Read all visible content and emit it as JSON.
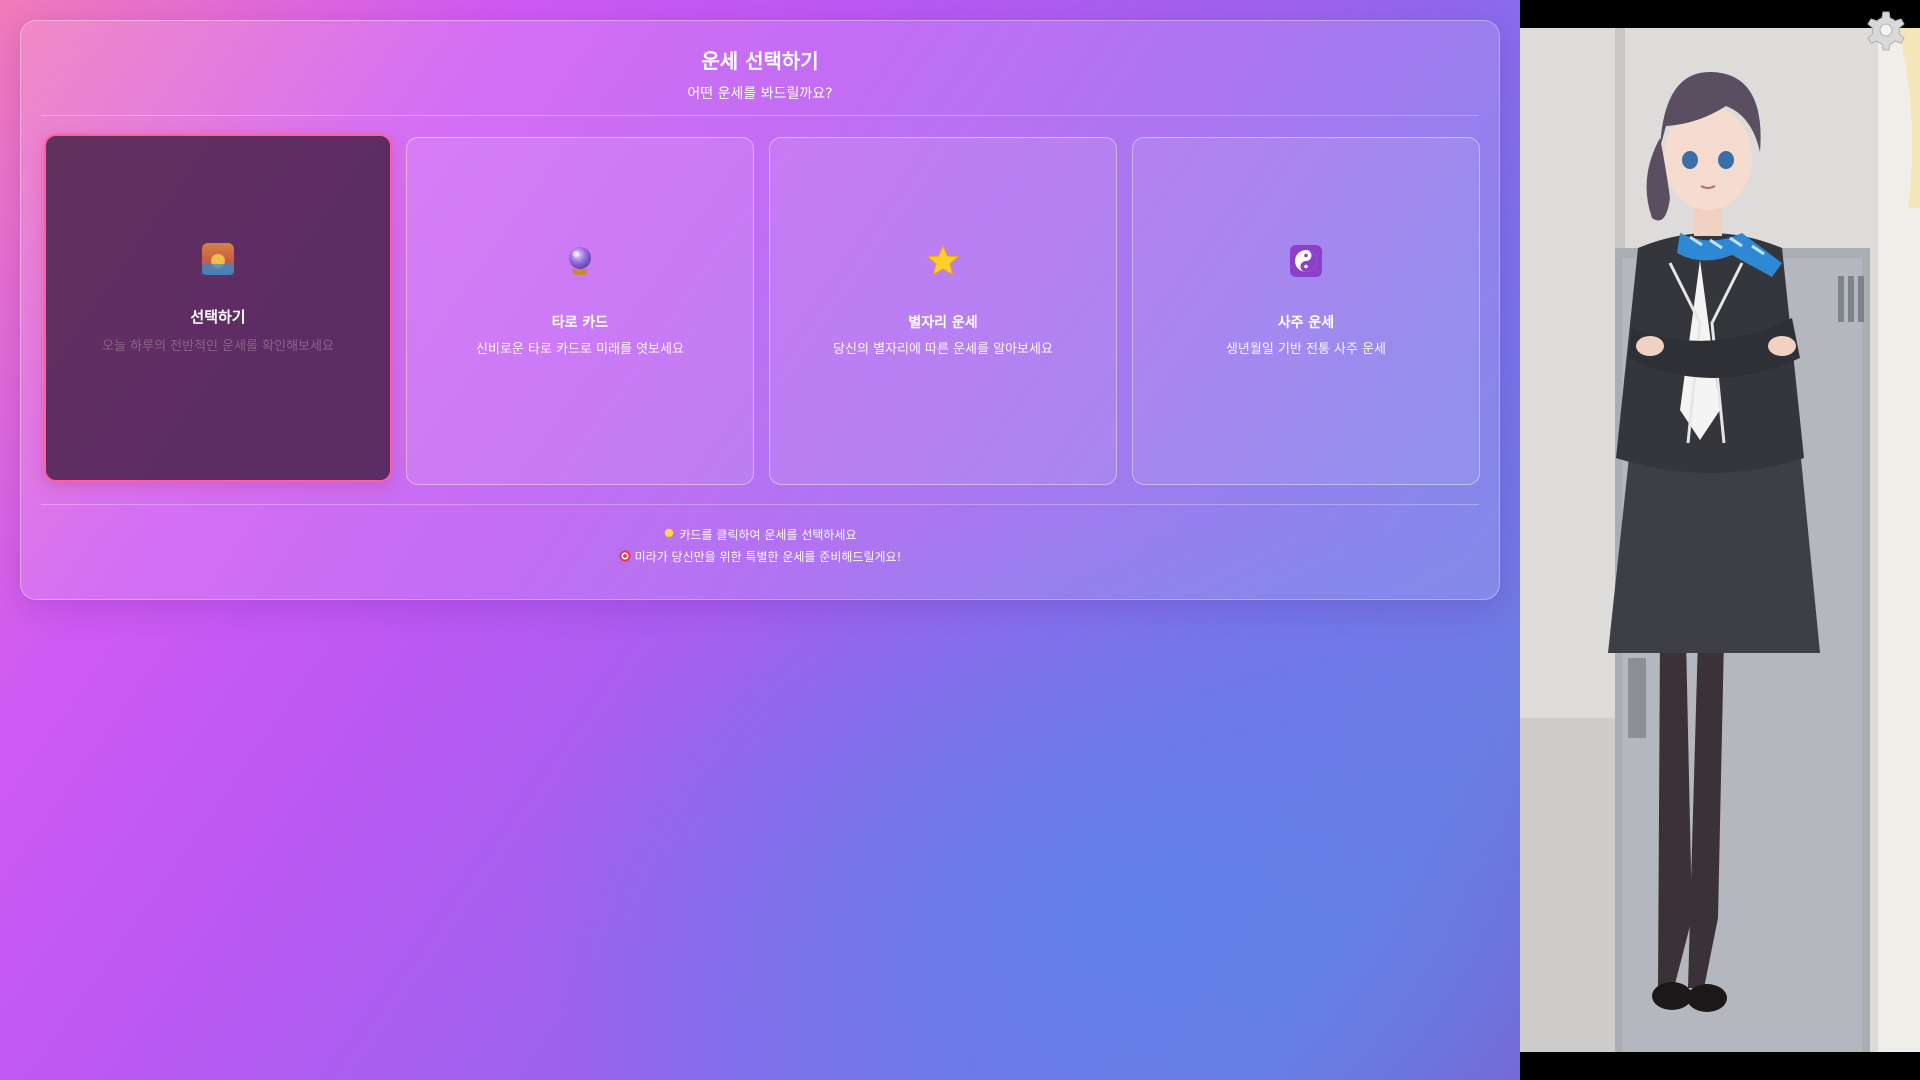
{
  "selector": {
    "title": "운세 선택하기",
    "subtitle": "어떤 운세를 봐드릴까요?"
  },
  "cards": [
    {
      "icon": "sunrise-icon",
      "label": "선택하기",
      "description": "오늘 하루의 전반적인 운세를 확인해보세요",
      "selected": true
    },
    {
      "icon": "crystal-ball-icon",
      "label": "타로 카드",
      "description": "신비로운 타로 카드로 미래를 엿보세요",
      "selected": false
    },
    {
      "icon": "star-icon",
      "label": "별자리 운세",
      "description": "당신의 별자리에 따른 운세를 알아보세요",
      "selected": false
    },
    {
      "icon": "yin-yang-icon",
      "label": "사주 운세",
      "description": "생년월일 기반 전통 사주 운세",
      "selected": false
    }
  ],
  "hints": [
    {
      "icon": "lightbulb-icon",
      "text": "카드를 클릭하여 운세를 선택하세요"
    },
    {
      "icon": "target-icon",
      "text": "미라가 당신만을 위한 특별한 운세를 준비해드릴게요!"
    }
  ],
  "colors": {
    "selected_border": "#ff5f9c",
    "gradient_start": "#f27bb9",
    "gradient_mid": "#bb58f3",
    "gradient_end": "#6e7be3"
  },
  "settings": {
    "icon": "gear-icon"
  }
}
